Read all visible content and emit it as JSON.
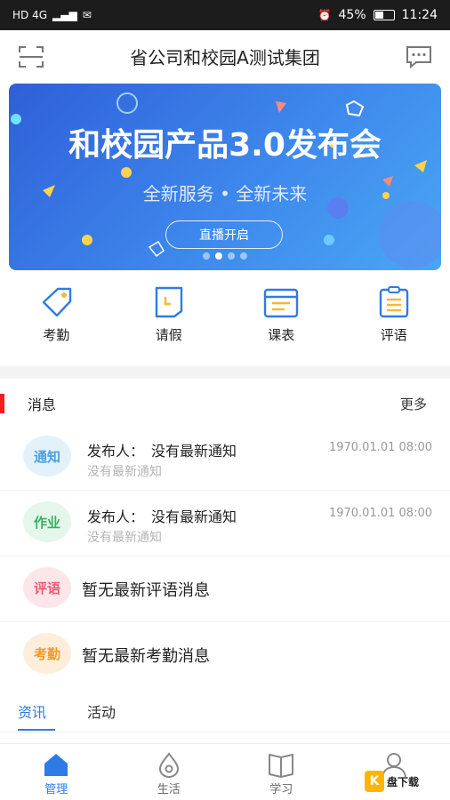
{
  "status_bar": {
    "left_text": "HD 4G",
    "battery": "45%",
    "time": "11:24"
  },
  "header": {
    "title": "省公司和校园A测试集团"
  },
  "banner": {
    "headline": "和校园产品3.0发布会",
    "subtitle": "全新服务 • 全新未来",
    "button": "直播开启",
    "active_slide": 2,
    "slides": 4
  },
  "quick_menu": [
    {
      "label": "考勤",
      "icon": "tag-icon"
    },
    {
      "label": "请假",
      "icon": "leave-icon"
    },
    {
      "label": "课表",
      "icon": "calendar-icon"
    },
    {
      "label": "评语",
      "icon": "clipboard-icon"
    }
  ],
  "messages": {
    "title": "消息",
    "more": "更多",
    "items": [
      {
        "badge": "通知",
        "publisher_label": "发布人：",
        "publisher": "没有最新通知",
        "subtitle": "没有最新通知",
        "time": "1970.01.01 08:00"
      },
      {
        "badge": "作业",
        "publisher_label": "发布人：",
        "publisher": "没有最新通知",
        "subtitle": "没有最新通知",
        "time": "1970.01.01 08:00"
      },
      {
        "badge": "评语",
        "text": "暂无最新评语消息"
      },
      {
        "badge": "考勤",
        "text": "暂无最新考勤消息"
      }
    ]
  },
  "tabs": [
    {
      "label": "资讯",
      "active": true
    },
    {
      "label": "活动",
      "active": false
    }
  ],
  "bottom_nav": [
    {
      "label": "管理",
      "icon": "home-icon",
      "active": true
    },
    {
      "label": "生活",
      "icon": "drop-icon",
      "active": false
    },
    {
      "label": "学习",
      "icon": "book-icon",
      "active": false
    },
    {
      "label": "我的",
      "icon": "user-icon",
      "active": false
    }
  ],
  "watermark": {
    "letter": "K",
    "text": "盘下载"
  },
  "colors": {
    "accent": "#2f7be6",
    "banner": "#3f8bee",
    "marker": "#f41f1f"
  }
}
